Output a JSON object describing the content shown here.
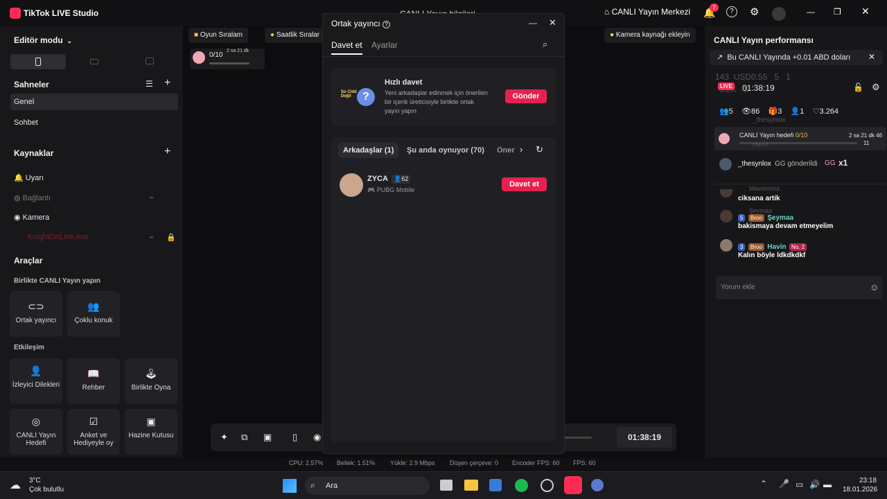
{
  "window": {
    "app_title": "TikTok LIVE Studio",
    "center_title": "CANLI Yayın bilgileri",
    "live_center": "CANLI Yayın Merkezi",
    "notification_count": "7"
  },
  "left": {
    "mode_label": "Editör modu",
    "scenes_title": "Sahneler",
    "scenes": [
      "Genel",
      "Sohbet"
    ],
    "sources_title": "Kaynaklar",
    "sources": [
      "Uyarı",
      "Bağlantı",
      "Kamera",
      "KnightOnLine.exe"
    ],
    "tools_title": "Araçlar",
    "tools_sub1": "Birlikte CANLI Yayın yapın",
    "tools_row1": [
      "Ortak yayıncı",
      "Çoklu konuk"
    ],
    "tools_sub2": "Etkileşim",
    "tools_row2": [
      "İzleyici Dilekleri",
      "Rehber",
      "Birlikte Oyna"
    ],
    "tools_row3": [
      "CANLI Yayın Hedefi",
      "Anket ve Hediyeyle oy",
      "Hazine Kutusu"
    ]
  },
  "center": {
    "pill_ranking": "Oyun Sıralam",
    "pill_hourly": "Saatlik Sıralar",
    "pill_camera": "Kamera kaynağı ekleyin",
    "goal_value": "0/10",
    "goal_time": "2 sa 21 dk",
    "timer": "01:38:19"
  },
  "modal": {
    "title": "Ortak yayıncı",
    "tabs": [
      "Davet et",
      "Ayarlar"
    ],
    "quick_title": "Hızlı davet",
    "quick_desc": "Yeni arkadaşlar edinmek için önerilen bir içerik üreticisiyle birlikte ortak yayın yapın",
    "quick_avatar_text": "So Cidd Değil",
    "quick_button": "Gönder",
    "filter_tabs": [
      "Arkadaşlar (1)",
      "Şu anda oynuyor (70)",
      "Öner"
    ],
    "friend_name": "ZYCA",
    "friend_count": "62",
    "friend_game": "PUBG Mobile",
    "invite_button": "Davet et"
  },
  "right": {
    "title": "CANLI Yayın performansı",
    "banner": "Bu CANLI Yayında +0.01 ABD doları",
    "live_tag": "LIVE",
    "live_time": "01:38:19",
    "ghost_stats": [
      "143",
      "USD0.55",
      "5",
      "1",
      "3.2K",
      "3"
    ],
    "stats": [
      "5",
      "86",
      "3",
      "1",
      "3.264"
    ],
    "goal_label": "CANLI Yayın hedefi",
    "goal_value": "0/10",
    "goal_time": "2 sa 21 dk 46",
    "goal_sub": "11",
    "ghost_name1": "_thesynlox",
    "ghost_name2": "Havin",
    "ghost_name3": "Mavidoona",
    "ghost_name4": "Şeymaa",
    "gift_user": "_thesynlox",
    "gift_text": "GG gönderildi",
    "gift_mult": "x1",
    "msg1": "ciksana artik",
    "msg2_level": "5",
    "msg2_badge": "Broo",
    "msg2_user": "Şeymaa",
    "msg2": "bakismaya devam etmeyelim",
    "msg3_level": "3",
    "msg3_badge": "Broo",
    "msg3_user": "Havin",
    "msg3_rank": "No. 2",
    "msg3": "Kalın böyle ldkdkdkf",
    "comment_placeholder": "Yorum ekle"
  },
  "status": {
    "items": [
      "CPU: 2.57%",
      "Bellek: 1.51%",
      "Yükle: 2.9 Mbps",
      "Düşen çerçeve: 0",
      "Encoder FPS: 60",
      "FPS: 60"
    ]
  },
  "taskbar": {
    "weather_temp": "3°C",
    "weather_desc": "Çok bulutlu",
    "search": "Ara",
    "time": "23:18",
    "date": "18.01.2026"
  },
  "colors": {
    "accent": "#fe2c55",
    "button": "#e5214f",
    "bg": "#111113",
    "panel": "#18181b"
  }
}
